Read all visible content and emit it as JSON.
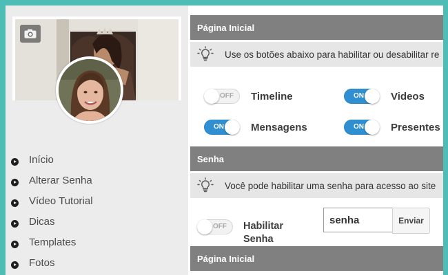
{
  "sidebar": {
    "menu": [
      {
        "label": "Início"
      },
      {
        "label": "Alterar Senha"
      },
      {
        "label": "Vídeo Tutorial"
      },
      {
        "label": "Dicas"
      },
      {
        "label": "Templates"
      },
      {
        "label": "Fotos"
      }
    ]
  },
  "sections": {
    "pagina_inicial": {
      "title": "Página Inicial",
      "hint": "Use os botões abaixo para habilitar ou desabilitar re",
      "toggles": [
        {
          "label": "Timeline",
          "state": "OFF"
        },
        {
          "label": "Videos",
          "state": "ON"
        },
        {
          "label": "Mensagens",
          "state": "ON"
        },
        {
          "label": "Presentes",
          "state": "ON"
        }
      ]
    },
    "senha": {
      "title": "Senha",
      "hint": "Você pode habilitar uma senha para acesso ao site",
      "toggle": {
        "label": "Habilitar Senha",
        "state": "OFF"
      },
      "password_value": "senha",
      "send_label": "Enviar"
    },
    "pagina_inicial_2": {
      "title": "Página Inicial"
    }
  },
  "colors": {
    "accent": "#2f8fd0",
    "header": "#808080",
    "frame": "#4dbdb5"
  }
}
